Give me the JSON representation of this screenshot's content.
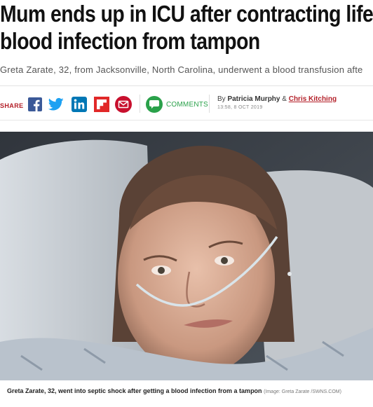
{
  "article": {
    "headline_line1": "Mum ends up in ICU after contracting life",
    "headline_line2": "blood infection from tampon",
    "standfirst": "Greta Zarate, 32, from Jacksonville, North Carolina, underwent a blood transfusion afte"
  },
  "share": {
    "label": "SHARE",
    "buttons": [
      {
        "name": "facebook",
        "icon": "facebook-icon",
        "color": "#3b5998"
      },
      {
        "name": "twitter",
        "icon": "twitter-icon",
        "color": "#1da1f2"
      },
      {
        "name": "linkedin",
        "icon": "linkedin-icon",
        "color": "#0077b5"
      },
      {
        "name": "flipboard",
        "icon": "flipboard-icon",
        "color": "#e12828"
      },
      {
        "name": "email",
        "icon": "email-icon",
        "color": "#c8102e"
      }
    ],
    "comments_label": "COMMENTS",
    "comments_color": "#2aa14a"
  },
  "byline": {
    "prefix": "By",
    "author1": "Patricia Murphy",
    "amp": "&",
    "author2": "Chris Kitching",
    "timestamp": "13:58, 8 OCT 2019"
  },
  "image": {
    "caption_bold": "Greta Zarate, 32, went into septic shock after getting a blood infection from a tampon",
    "credit": "(Image: Greta Zarate /SWNS.COM)"
  },
  "colors": {
    "accent": "#b31f28",
    "headline": "#111111"
  }
}
